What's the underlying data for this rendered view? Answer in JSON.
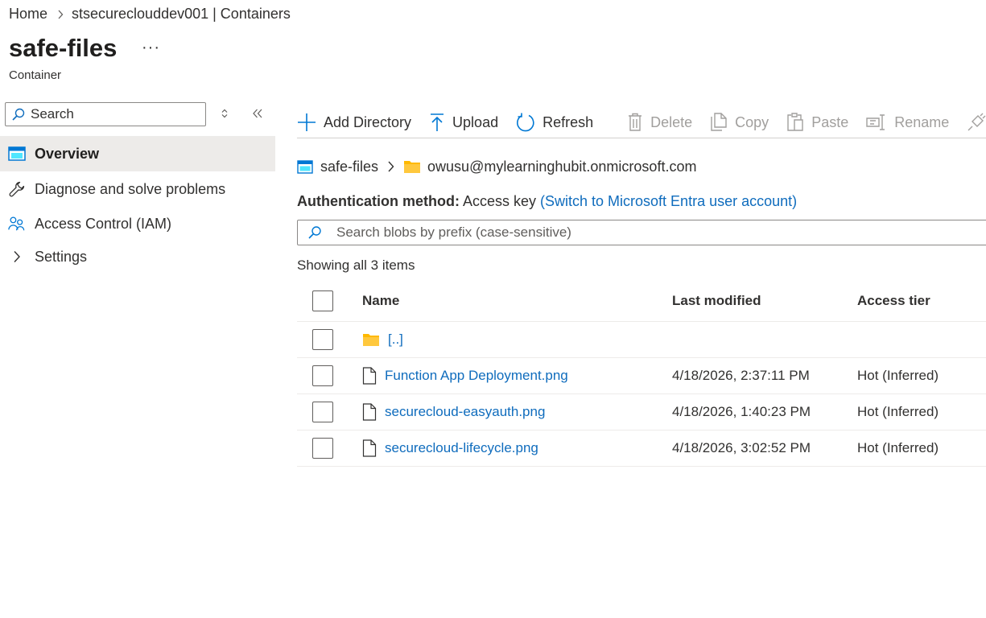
{
  "breadcrumb": {
    "home": "Home",
    "account": "stsecureclouddev001 | Containers"
  },
  "header": {
    "title": "safe-files",
    "more": "···",
    "subtitle": "Container"
  },
  "sidebar": {
    "search_placeholder": "Search",
    "items": [
      {
        "label": "Overview",
        "icon": "container-icon",
        "active": true
      },
      {
        "label": "Diagnose and solve problems",
        "icon": "wrench-icon"
      },
      {
        "label": "Access Control (IAM)",
        "icon": "people-icon"
      },
      {
        "label": "Settings",
        "icon": "chevron-right-icon"
      }
    ]
  },
  "toolbar": {
    "add_directory": "Add Directory",
    "upload": "Upload",
    "refresh": "Refresh",
    "delete": "Delete",
    "copy": "Copy",
    "paste": "Paste",
    "rename": "Rename"
  },
  "path": {
    "container": "safe-files",
    "folder": "owusu@mylearninghubit.onmicrosoft.com"
  },
  "auth": {
    "label": "Authentication method:",
    "value": "Access key",
    "switch_link": "(Switch to Microsoft Entra user account)"
  },
  "blob_search": {
    "placeholder": "Search blobs by prefix (case-sensitive)"
  },
  "showing": "Showing all 3 items",
  "table": {
    "columns": {
      "name": "Name",
      "last_modified": "Last modified",
      "access_tier": "Access tier"
    },
    "parent": {
      "name": "[..]"
    },
    "rows": [
      {
        "name": "Function App Deployment.png",
        "last_modified": "4/18/2026, 2:37:11 PM",
        "access_tier": "Hot (Inferred)"
      },
      {
        "name": "securecloud-easyauth.png",
        "last_modified": "4/18/2026, 1:40:23 PM",
        "access_tier": "Hot (Inferred)"
      },
      {
        "name": "securecloud-lifecycle.png",
        "last_modified": "4/18/2026, 3:02:52 PM",
        "access_tier": "Hot (Inferred)"
      }
    ]
  },
  "colors": {
    "accent": "#0f6cbd",
    "folder": "#ffb900",
    "active_bg": "#edebe9",
    "disabled": "#a19f9d"
  }
}
